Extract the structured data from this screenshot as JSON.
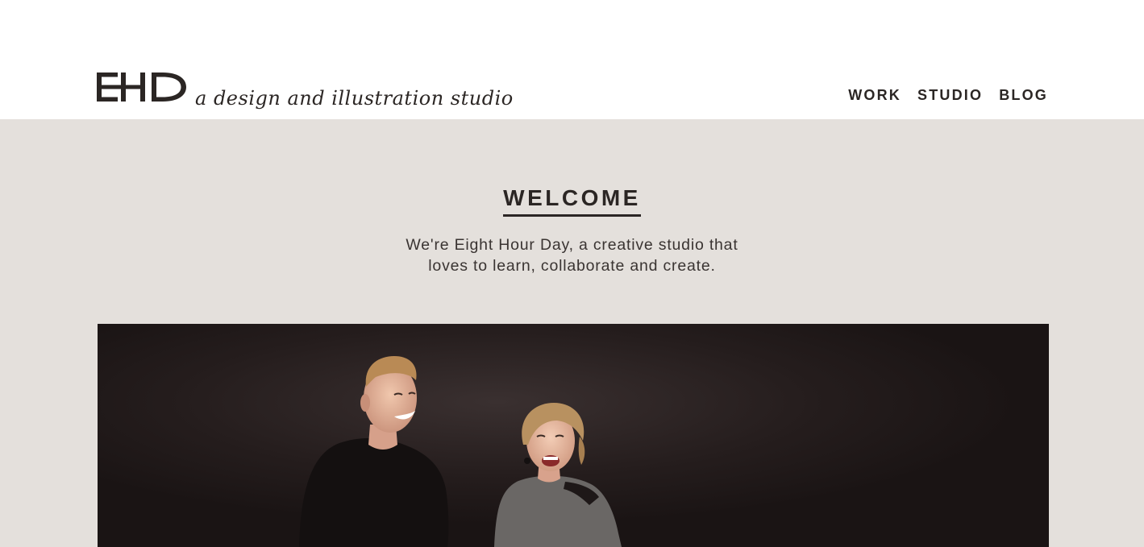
{
  "header": {
    "logo_text": "EHD",
    "tagline": "a design and illustration studio",
    "nav": [
      {
        "label": "WORK"
      },
      {
        "label": "STUDIO"
      },
      {
        "label": "BLOG"
      }
    ]
  },
  "hero": {
    "title": "WELCOME",
    "intro_lines": [
      "We're Eight Hour Day, a creative studio that",
      "loves to learn, collaborate and create."
    ]
  },
  "colors": {
    "hero_background": "#e4e0dc",
    "text": "#2b2624",
    "photo_background": "#1c1616"
  }
}
